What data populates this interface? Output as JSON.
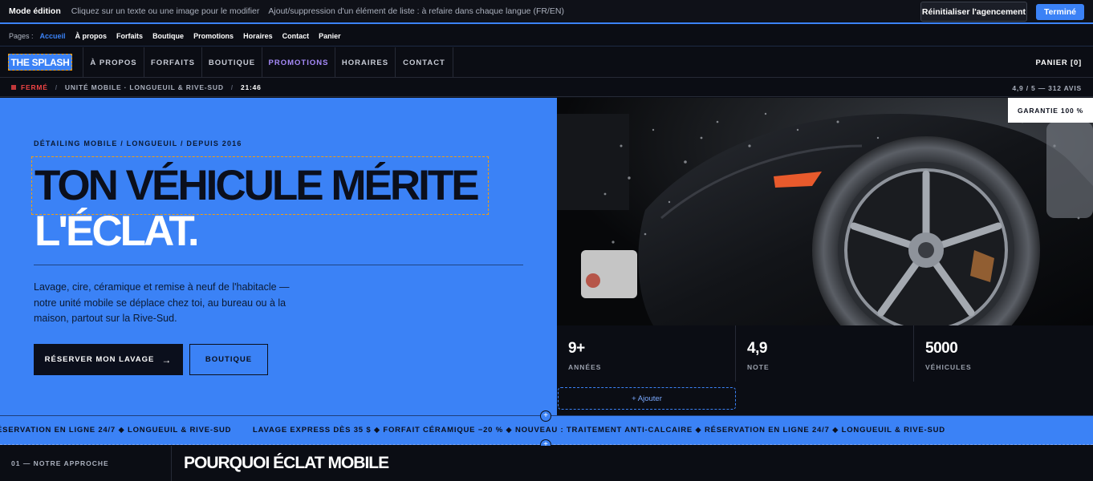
{
  "editbar": {
    "mode": "Mode édition",
    "hint1": "Cliquez sur un texte ou une image pour le modifier",
    "hint2": "Ajout/suppression d'un élément de liste : à refaire dans chaque langue (FR/EN)",
    "reset_label": "Réinitialiser l'agencement",
    "done_label": "Terminé"
  },
  "pagesbar": {
    "label": "Pages :",
    "pages": [
      "Accueil",
      "À propos",
      "Forfaits",
      "Boutique",
      "Promotions",
      "Horaires",
      "Contact",
      "Panier"
    ]
  },
  "nav": {
    "logo": "THE SPLASH",
    "items": [
      "À PROPOS",
      "FORFAITS",
      "BOUTIQUE",
      "PROMOTIONS",
      "HORAIRES",
      "CONTACT"
    ],
    "cart": "PANIER [0]"
  },
  "status": {
    "state": "FERMÉ",
    "location": "UNITÉ MOBILE · LONGUEUIL & RIVE-SUD",
    "time": "21:46",
    "rating": "4,9 / 5 — 312 AVIS"
  },
  "hero": {
    "eyebrow": "DÉTAILING MOBILE / LONGUEUIL / DEPUIS 2016",
    "headline_line1": "TON VÉHICULE MÉRITE",
    "headline_line2": "L'ÉCLAT.",
    "lead": "Lavage, cire, céramique et remise à neuf de l'habitacle — notre unité mobile se déplace chez toi, au bureau ou à la maison, partout sur la Rive-Sud.",
    "cta_primary": "RÉSERVER MON LAVAGE",
    "cta_arrow": "→",
    "cta_secondary": "BOUTIQUE"
  },
  "photo": {
    "badge": "GARANTIE 100 %"
  },
  "stats": {
    "items": [
      {
        "value": "9+",
        "label": "ANNÉES"
      },
      {
        "value": "4,9",
        "label": "NOTE"
      },
      {
        "value": "5000",
        "label": "VÉHICULES"
      }
    ],
    "add_label": "+ Ajouter"
  },
  "ticker": {
    "segment1": "ÉSERVATION EN LIGNE 24/7 ◆ LONGUEUIL & RIVE-SUD",
    "segment2": "LAVAGE EXPRESS DÈS 35 $ ◆ FORFAIT CÉRAMIQUE −20 % ◆ NOUVEAU : TRAITEMENT ANTI-CALCAIRE ◆ RÉSERVATION EN LIGNE 24/7 ◆ LONGUEUIL & RIVE-SUD"
  },
  "section": {
    "number": "01 —  NOTRE APPROCHE",
    "title": "POURQUOI ÉCLAT MOBILE"
  },
  "colors": {
    "accent": "#3b82f6",
    "promo": "#a78bfa",
    "closed": "#ef4444",
    "dark": "#0b0d14"
  }
}
